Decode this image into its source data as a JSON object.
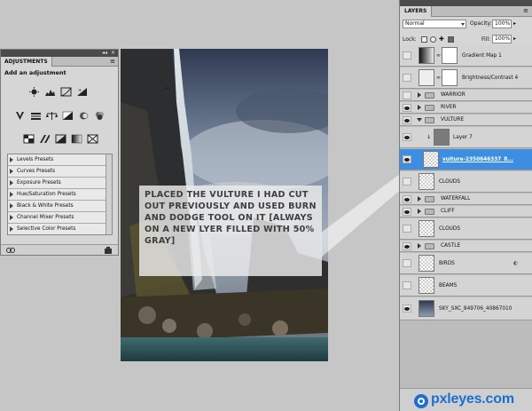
{
  "adjustments": {
    "tab_label": "ADJUSTMENTS",
    "title": "Add an adjustment",
    "icon_rows": [
      [
        "brightness-contrast-icon",
        "levels-icon",
        "curves-icon",
        "exposure-icon"
      ],
      [
        "vibrance-icon",
        "hue-saturation-icon",
        "color-balance-icon",
        "black-white-icon",
        "photo-filter-icon",
        "channel-mixer-icon"
      ],
      [
        "invert-icon",
        "posterize-icon",
        "threshold-icon",
        "gradient-map-icon",
        "selective-color-icon"
      ]
    ],
    "presets": [
      "Levels Presets",
      "Curves Presets",
      "Exposure Presets",
      "Hue/Saturation Presets",
      "Black & White Presets",
      "Channel Mixer Presets",
      "Selective Color Presets"
    ]
  },
  "callout": {
    "text": "PLACED THE VULTURE I HAD CUT OUT PREVIOUSLY AND USED BURN AND DODGE TOOL ON IT [ALWAYS ON A NEW LYER FILLED WITH 50% GRAY]"
  },
  "layers_panel": {
    "tab_label": "LAYERS",
    "blend_mode": "Normal",
    "opacity_label": "Opacity:",
    "opacity_value": "100%",
    "lock_label": "Lock:",
    "fill_label": "Fill:",
    "fill_value": "100%",
    "layers": [
      {
        "name": "Gradient Map 1",
        "kind": "adjustment",
        "visible": false
      },
      {
        "name": "Brightness/Contrast 4",
        "kind": "adjustment",
        "visible": false
      },
      {
        "name": "WARRIOR",
        "kind": "group",
        "visible": false,
        "expanded": false
      },
      {
        "name": "RIVER",
        "kind": "group",
        "visible": true,
        "expanded": false
      },
      {
        "name": "VULTURE",
        "kind": "group",
        "visible": true,
        "expanded": true
      },
      {
        "name": "Layer 7",
        "kind": "layer",
        "visible": true
      },
      {
        "name": "vulture-2350646337_8...",
        "kind": "layer",
        "visible": true,
        "selected": true
      },
      {
        "name": "CLOUDS",
        "kind": "layer",
        "visible": false
      },
      {
        "name": "WATERFALL",
        "kind": "group",
        "visible": true,
        "expanded": false
      },
      {
        "name": "CLIFF",
        "kind": "group",
        "visible": true,
        "expanded": false
      },
      {
        "name": "CLOUDS",
        "kind": "layer",
        "visible": false
      },
      {
        "name": "CASTLE",
        "kind": "group",
        "visible": true,
        "expanded": false
      },
      {
        "name": "BIRDS",
        "kind": "layer",
        "visible": false
      },
      {
        "name": "BEAMS",
        "kind": "layer",
        "visible": false
      },
      {
        "name": "SKY_SXC_849706_40867010",
        "kind": "layer",
        "visible": true
      }
    ]
  },
  "watermark": {
    "text": "pxleyes.com"
  }
}
